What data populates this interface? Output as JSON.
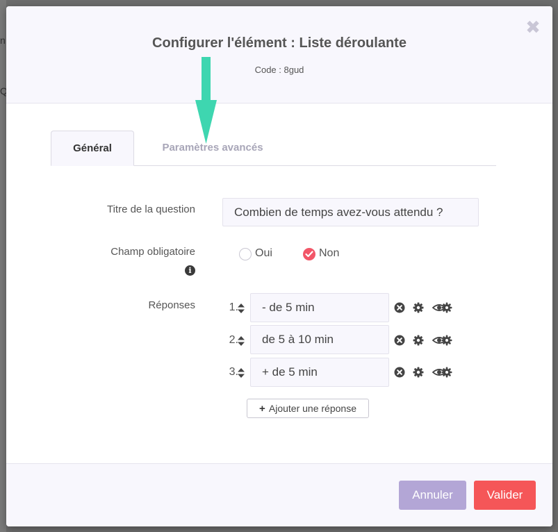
{
  "background_page": {
    "fragment_1": "n",
    "fragment_2": "Q"
  },
  "modal": {
    "title": "Configurer l'élément : Liste déroulante",
    "code": "Code : 8gud",
    "close_glyph": "✖"
  },
  "tabs": [
    {
      "label": "Général",
      "active": true
    },
    {
      "label": "Paramètres avancés",
      "active": false
    }
  ],
  "form": {
    "question_title_label": "Titre de la question",
    "question_title_value": "Combien de temps avez-vous attendu ?",
    "required_label": "Champ obligatoire",
    "required_options": [
      {
        "label": "Oui",
        "selected": false
      },
      {
        "label": "Non",
        "selected": true
      }
    ],
    "answers_label": "Réponses",
    "answers": [
      {
        "number": "1.",
        "value": "- de 5 min"
      },
      {
        "number": "2.",
        "value": "de 5 à 10 min"
      },
      {
        "number": "3.",
        "value": "+ de 5 min"
      }
    ],
    "add_answer_label": "Ajouter une réponse"
  },
  "footer": {
    "cancel_label": "Annuler",
    "confirm_label": "Valider"
  },
  "colors": {
    "accent_red": "#f55658",
    "cancel_purple": "#b3a6d6",
    "annotation_arrow": "#3ed6b0"
  },
  "icons": [
    "close-icon",
    "info-icon",
    "sort-icon",
    "delete-icon",
    "gear-icon",
    "visibility-settings-icon",
    "plus-icon",
    "check-icon"
  ]
}
